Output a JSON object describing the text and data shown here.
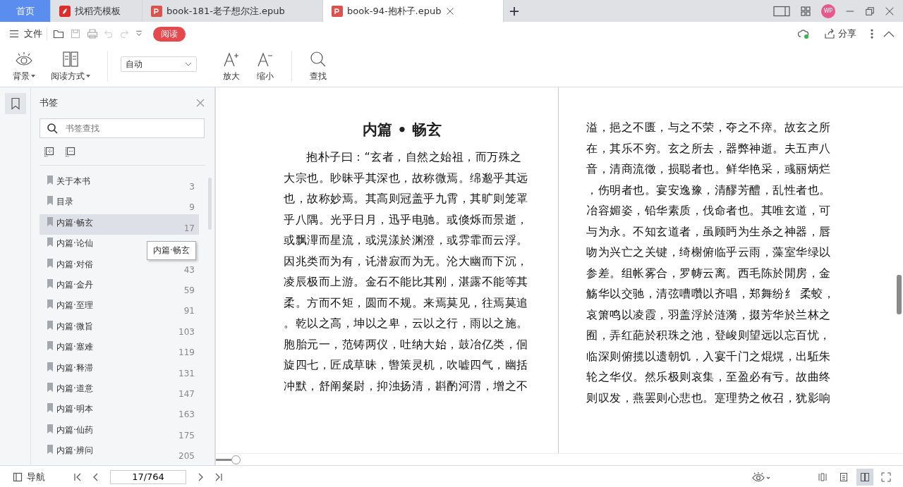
{
  "tabs": [
    {
      "label": "首页",
      "kind": "home",
      "selected": false
    },
    {
      "label": "找稻壳模板",
      "kind": "docer",
      "selected": false
    },
    {
      "label": "book-181-老子想尔注.epub",
      "kind": "pdf",
      "selected": false
    },
    {
      "label": "book-94-抱朴子.epub",
      "kind": "pdf",
      "selected": true
    }
  ],
  "avatar": "WP",
  "menu": {
    "file": "文件",
    "read": "阅读",
    "share": "分享"
  },
  "ribbon": {
    "background": "背景",
    "read_mode": "阅读方式",
    "zoom_select": "自动",
    "zoom_in": "放大",
    "zoom_out": "缩小",
    "find": "查找"
  },
  "sidebar": {
    "title": "书签",
    "search_placeholder": "书签查找",
    "items": [
      {
        "label": "关于本书",
        "page": "3",
        "selected": false
      },
      {
        "label": "目录",
        "page": "9",
        "selected": false
      },
      {
        "label": "内篇·畅玄",
        "page": "17",
        "selected": true
      },
      {
        "label": "内篇·论仙",
        "selected": false
      },
      {
        "label": "内篇·对俗",
        "page": "43",
        "selected": false
      },
      {
        "label": "内篇·金丹",
        "page": "59",
        "selected": false
      },
      {
        "label": "内篇·至理",
        "page": "91",
        "selected": false
      },
      {
        "label": "内篇·微旨",
        "page": "103",
        "selected": false
      },
      {
        "label": "内篇·塞难",
        "page": "119",
        "selected": false
      },
      {
        "label": "内篇·释滞",
        "page": "131",
        "selected": false
      },
      {
        "label": "内篇·道意",
        "page": "147",
        "selected": false
      },
      {
        "label": "内篇·明本",
        "page": "163",
        "selected": false
      },
      {
        "label": "内篇·仙药",
        "page": "175",
        "selected": false
      },
      {
        "label": "内篇·辨问",
        "page": "205",
        "selected": false
      }
    ],
    "tooltip": "内篇·畅玄"
  },
  "pages": [
    {
      "title": "内篇 • 畅玄",
      "lines": [
        "抱朴子曰：“玄者，自然之始祖，而万殊之",
        "大宗也。眇昧乎其深也，故称微焉。绵邈乎其远",
        "也，故称妙焉。其高则冠盖乎九霄，其旷则笼罩",
        "乎八隅。光乎日月，迅乎电驰。或倏烁而景逝，",
        "或飘滭而星流，或滉漾於渊澄，或雰霏而云浮。",
        "因兆类而为有，讬潜寂而为无。沦大幽而下沉，",
        "凌辰极而上游。金石不能比其刚，湛露不能等其",
        "柔。方而不矩，圆而不规。来焉莫见，往焉莫追",
        "。乾以之高，坤以之卑，云以之行，雨以之施。",
        "胞胎元一，范铸两仪，吐纳大始，鼓冶亿类，佪",
        "旋四七，匠成草昧，辔策灵机，吹嘘四气，幽括",
        "冲默，舒阐粲尉，抑浊扬清，斟酌河渭，增之不"
      ]
    },
    {
      "lines": [
        "溢，挹之不匮，与之不荣，夺之不瘁。故玄之所",
        "在，其乐不穷。玄之所去，器弊神逝。夫五声八",
        "音，清商流徵，损聪者也。鲜华艳采，彧丽炳烂",
        "，伤明者也。宴安逸豫，清醪芳醴，乱性者也。",
        "冶容媚姿，铅华素质，伐命者也。其唯玄道，可",
        "与为永。不知玄道者，虽顾眄为生杀之神器，唇",
        "吻为兴亡之关键，绮榭俯临乎云雨，藻室华绿以",
        "参差。组帐雾合，罗帱云离。西毛陈於閒房，金",
        "觞华以交驰，清弦嘈囋以齐唱，郑舞纷纟 柔蛟，",
        "哀箫鸣以凌霞，羽盖浮於涟漪，掇芳华於兰林之",
        "囿，弄红葩於积珠之池，登峻则望远以忘百忧，",
        "临深则俯揽以遗朝饥，入宴千门之焜熀，出駈朱",
        "轮之华仪。然乐极则哀集，至盈必有亏。故曲终",
        "则叹发，燕罢则心悲也。寔理势之攸召，犹影响"
      ]
    }
  ],
  "status": {
    "nav": "导航",
    "page_input": "17/764",
    "view_modes": [
      {
        "kind": "scroll",
        "selected": false
      },
      {
        "kind": "single",
        "selected": false
      },
      {
        "kind": "double",
        "selected": true
      },
      {
        "kind": "full",
        "selected": false
      }
    ]
  }
}
